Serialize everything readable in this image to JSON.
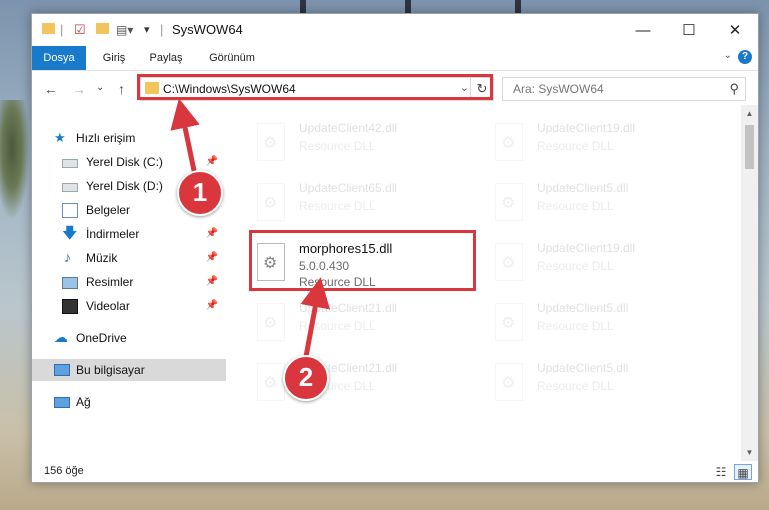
{
  "window": {
    "title": "SysWOW64",
    "minimize": "—",
    "maximize": "☐",
    "close": "✕"
  },
  "ribbon": {
    "tabs": [
      "Dosya",
      "Giriş",
      "Paylaş",
      "Görünüm"
    ],
    "expand": "⌄",
    "help": "?"
  },
  "nav": {
    "back": "←",
    "forward": "→",
    "recent": "⌄",
    "up": "↑",
    "address": "C:\\Windows\\SysWOW64",
    "address_dropdown": "⌄",
    "refresh": "↻",
    "search_placeholder": "Ara: SysWOW64",
    "search_icon": "⚲"
  },
  "sidebar": {
    "items": [
      {
        "label": "Hızlı erişim",
        "icon": "star-icon"
      },
      {
        "label": "Yerel Disk (C:)",
        "icon": "drive-icon",
        "pinned": true
      },
      {
        "label": "Yerel Disk (D:)",
        "icon": "drive-icon",
        "pinned": true
      },
      {
        "label": "Belgeler",
        "icon": "documents-icon",
        "pinned": true
      },
      {
        "label": "İndirmeler",
        "icon": "download-icon",
        "pinned": true
      },
      {
        "label": "Müzik",
        "icon": "music-icon",
        "pinned": true
      },
      {
        "label": "Resimler",
        "icon": "pictures-icon",
        "pinned": true
      },
      {
        "label": "Videolar",
        "icon": "videos-icon",
        "pinned": true
      },
      {
        "label": "OneDrive",
        "icon": "cloud-icon"
      },
      {
        "label": "Bu bilgisayar",
        "icon": "computer-icon",
        "selected": true
      },
      {
        "label": "Ağ",
        "icon": "network-icon"
      }
    ],
    "pin_glyph": "📌"
  },
  "files": {
    "focused": {
      "name": "morphores15.dll",
      "version": "5.0.0.430",
      "type": "Resource DLL"
    },
    "faded": [
      {
        "name": "UpdateClient42.dll",
        "type": "Resource DLL"
      },
      {
        "name": "UpdateClient19.dll",
        "type": "Resource DLL"
      },
      {
        "name": "UpdateClient65.dll",
        "type": "Resource DLL"
      },
      {
        "name": "UpdateClient5.dll",
        "type": "Resource DLL"
      },
      {
        "name": "UpdateClient19.dll",
        "type": "Resource DLL"
      },
      {
        "name": "UpdateClient21.dll",
        "type": "Resource DLL"
      },
      {
        "name": "UpdateClient5.dll",
        "type": "Resource DLL"
      },
      {
        "name": "UpdateClient21.dll",
        "type": "Resource DLL"
      },
      {
        "name": "UpdateClient5.dll",
        "type": "Resource DLL"
      }
    ]
  },
  "status": {
    "item_count": "156 öğe"
  },
  "annotations": {
    "step1": "1",
    "step2": "2",
    "color": "#d9363e"
  }
}
